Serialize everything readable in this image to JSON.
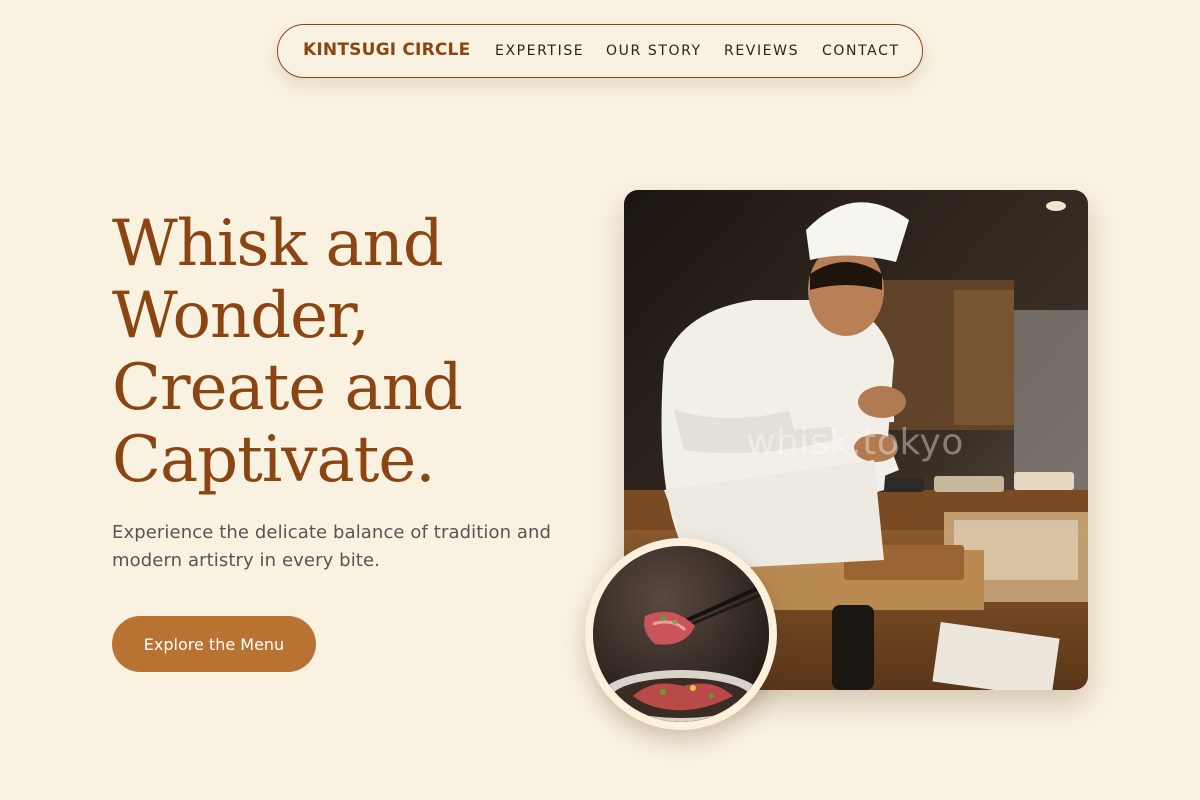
{
  "nav": {
    "brand": "KINTSUGI CIRCLE",
    "links": [
      "EXPERTISE",
      "OUR STORY",
      "REVIEWS",
      "CONTACT"
    ]
  },
  "hero": {
    "headline_lines": [
      "Whisk and",
      "Wonder,",
      "Create and",
      "Captivate."
    ],
    "subtitle": "Experience the delicate balance of tradition and modern artistry in every bite.",
    "cta_label": "Explore the Menu",
    "watermark": "whisk.tokyo"
  },
  "colors": {
    "background": "#faf2e1",
    "brand": "#8b4513",
    "accent": "#b87333"
  }
}
